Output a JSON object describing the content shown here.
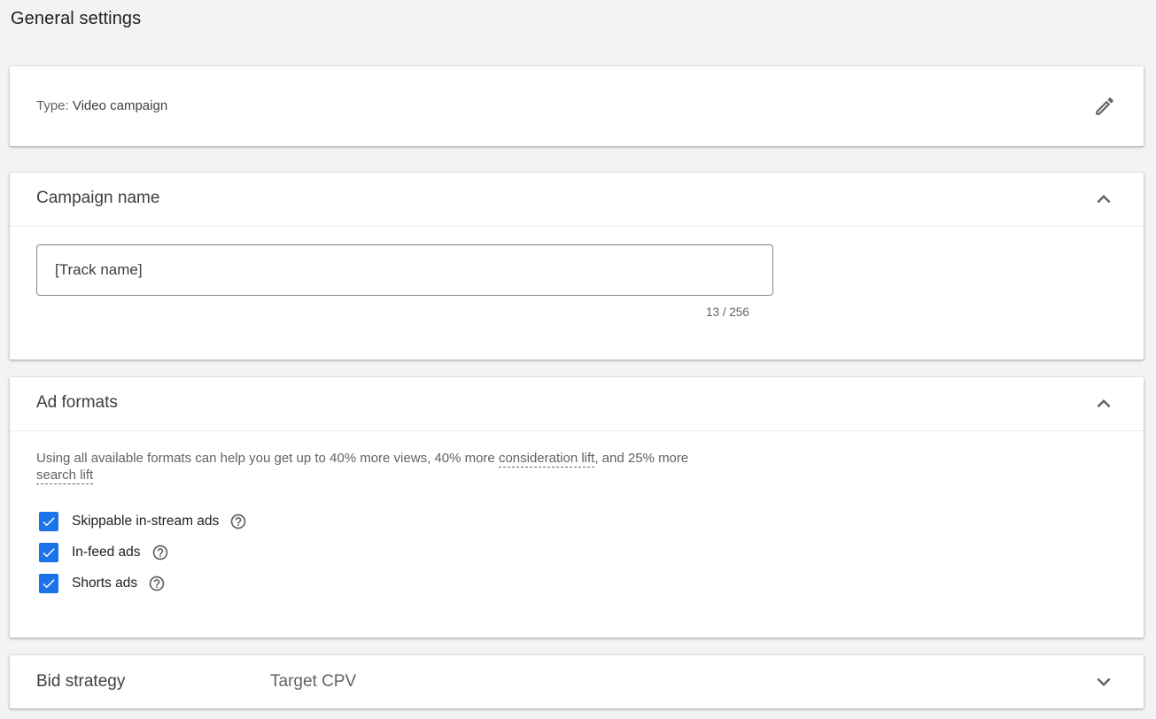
{
  "page": {
    "title": "General settings"
  },
  "type_card": {
    "label": "Type:",
    "value": "Video campaign",
    "edit_icon": "pencil-icon"
  },
  "campaign_name": {
    "title": "Campaign name",
    "input_value": "[Track name]",
    "char_count": "13 / 256",
    "collapse_icon": "chevron-up-icon"
  },
  "ad_formats": {
    "title": "Ad formats",
    "description_before": "Using all available formats can help you get up to 40% more views, 40% more ",
    "link_consideration": "consideration lift",
    "description_middle": ", and 25% more ",
    "link_search": "search lift",
    "options": [
      {
        "label": "Skippable in-stream ads",
        "checked": true
      },
      {
        "label": "In-feed ads",
        "checked": true
      },
      {
        "label": "Shorts ads",
        "checked": true
      }
    ],
    "collapse_icon": "chevron-up-icon"
  },
  "bid_strategy": {
    "title": "Bid strategy",
    "value": "Target CPV",
    "expand_icon": "chevron-down-icon"
  },
  "colors": {
    "accent": "#1a73e8",
    "background": "#f1f3f4",
    "text_primary": "#3c4043",
    "text_secondary": "#5f6368"
  }
}
